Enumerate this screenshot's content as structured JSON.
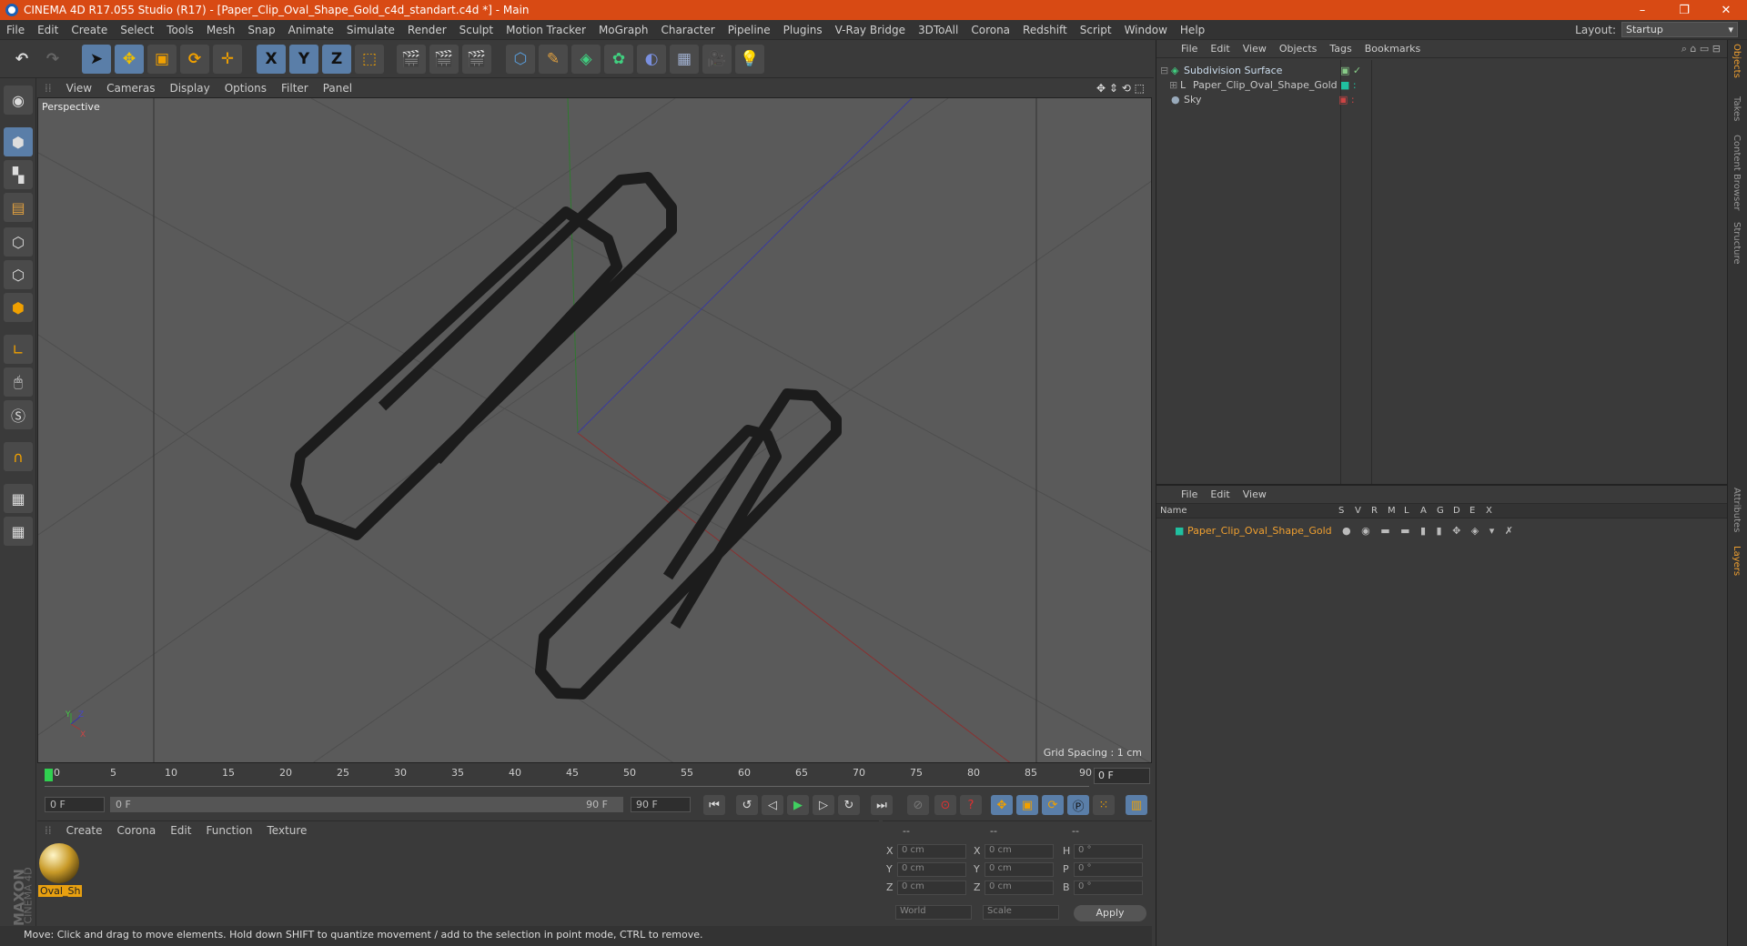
{
  "window": {
    "title": "CINEMA 4D R17.055 Studio (R17) - [Paper_Clip_Oval_Shape_Gold_c4d_standart.c4d *] - Main",
    "controls": [
      "–",
      "❐",
      "✕"
    ]
  },
  "menubar": {
    "items": [
      "File",
      "Edit",
      "Create",
      "Select",
      "Tools",
      "Mesh",
      "Snap",
      "Animate",
      "Simulate",
      "Render",
      "Sculpt",
      "Motion Tracker",
      "MoGraph",
      "Character",
      "Pipeline",
      "Plugins",
      "V-Ray Bridge",
      "3DToAll",
      "Corona",
      "Redshift",
      "Script",
      "Window",
      "Help"
    ],
    "layout_label": "Layout:",
    "layout_value": "Startup"
  },
  "toolbar": {
    "axis_x": "X",
    "axis_y": "Y",
    "axis_z": "Z"
  },
  "viewport": {
    "menu": [
      "View",
      "Cameras",
      "Display",
      "Options",
      "Filter",
      "Panel"
    ],
    "label": "Perspective",
    "grid_spacing": "Grid Spacing : 1 cm"
  },
  "timeline": {
    "ticks": [
      "0",
      "5",
      "10",
      "15",
      "20",
      "25",
      "30",
      "35",
      "40",
      "45",
      "50",
      "55",
      "60",
      "65",
      "70",
      "75",
      "80",
      "85",
      "90"
    ],
    "current_frame": "0 F",
    "start": "0 F",
    "range_start": "0 F",
    "range_end": "90 F",
    "end": "90 F"
  },
  "material_panel": {
    "menu": [
      "Create",
      "Corona",
      "Edit",
      "Function",
      "Texture"
    ],
    "material_name": "Oval_Sh"
  },
  "coordinates": {
    "header": [
      "--",
      "--",
      "--"
    ],
    "rows": [
      {
        "a": "X",
        "av": "0 cm",
        "b": "X",
        "bv": "0 cm",
        "c": "H",
        "cv": "0 °"
      },
      {
        "a": "Y",
        "av": "0 cm",
        "b": "Y",
        "bv": "0 cm",
        "c": "P",
        "cv": "0 °"
      },
      {
        "a": "Z",
        "av": "0 cm",
        "b": "Z",
        "bv": "0 cm",
        "c": "B",
        "cv": "0 °"
      }
    ],
    "space": "World",
    "mode": "Scale",
    "apply": "Apply"
  },
  "status": "Move: Click and drag to move elements. Hold down SHIFT to quantize movement / add to the selection in point mode, CTRL to remove.",
  "brand": {
    "maxon": "MAXON",
    "c4d": "CINEMA 4D"
  },
  "object_manager": {
    "menu": [
      "File",
      "Edit",
      "View",
      "Objects",
      "Tags",
      "Bookmarks"
    ],
    "objects": [
      {
        "name": "Subdivision Surface",
        "color": "#9ad0a0"
      },
      {
        "name": "Paper_Clip_Oval_Shape_Gold",
        "color": "#c8c8c8"
      },
      {
        "name": "Sky",
        "color": "#c8c8c8"
      }
    ]
  },
  "layer_manager": {
    "menu": [
      "File",
      "Edit",
      "View"
    ],
    "columns": [
      "Name",
      "S",
      "V",
      "R",
      "M",
      "L",
      "A",
      "G",
      "D",
      "E",
      "X"
    ],
    "layer_name": "Paper_Clip_Oval_Shape_Gold",
    "layer_color": "#20c0a0"
  },
  "side_tabs": [
    "Objects",
    "Takes",
    "Content Browser",
    "Structure",
    "Attributes",
    "Layers"
  ]
}
